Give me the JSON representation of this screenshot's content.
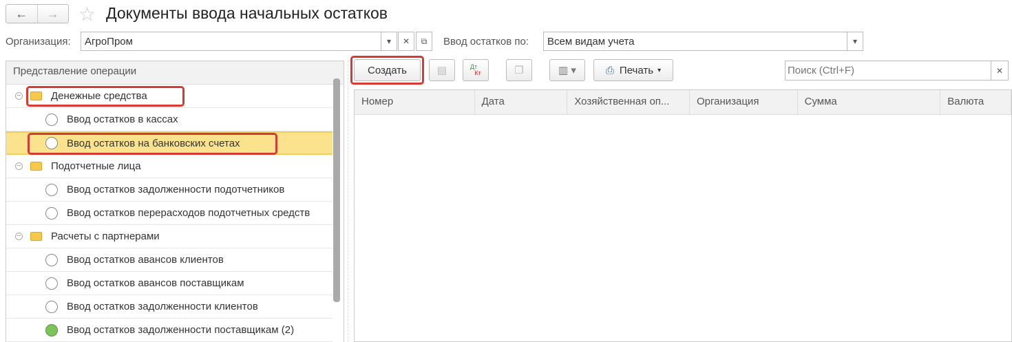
{
  "header": {
    "title": "Документы ввода начальных остатков",
    "back": "←",
    "forward": "→"
  },
  "filters": {
    "org_label": "Организация:",
    "org_value": "АгроПром",
    "mode_label": "Ввод остатков по:",
    "mode_value": "Всем видам учета"
  },
  "tree": {
    "header": "Представление операции",
    "rows": [
      {
        "type": "group",
        "label": "Денежные средства"
      },
      {
        "type": "item",
        "label": "Ввод остатков в кассах"
      },
      {
        "type": "item",
        "label": "Ввод остатков на банковских счетах",
        "selected": true
      },
      {
        "type": "group",
        "label": "Подотчетные лица"
      },
      {
        "type": "item",
        "label": "Ввод остатков задолженности подотчетников"
      },
      {
        "type": "item",
        "label": "Ввод остатков перерасходов подотчетных средств"
      },
      {
        "type": "group",
        "label": "Расчеты с партнерами"
      },
      {
        "type": "item",
        "label": "Ввод остатков авансов клиентов"
      },
      {
        "type": "item",
        "label": "Ввод остатков авансов поставщикам"
      },
      {
        "type": "item",
        "label": "Ввод остатков задолженности клиентов"
      },
      {
        "type": "item",
        "label": "Ввод остатков задолженности поставщикам (2)",
        "filled": true
      }
    ]
  },
  "toolbar": {
    "create": "Создать",
    "dtkt_top": "Дт",
    "dtkt_bottom": "Кт",
    "print": "Печать",
    "search_placeholder": "Поиск (Ctrl+F)"
  },
  "grid": {
    "columns": [
      "Номер",
      "Дата",
      "Хозяйственная оп...",
      "Организация",
      "Сумма",
      "Валюта"
    ]
  },
  "colors": {
    "highlight": "#d73a32",
    "selected": "#fbe38e",
    "green": "#7dc35b"
  }
}
